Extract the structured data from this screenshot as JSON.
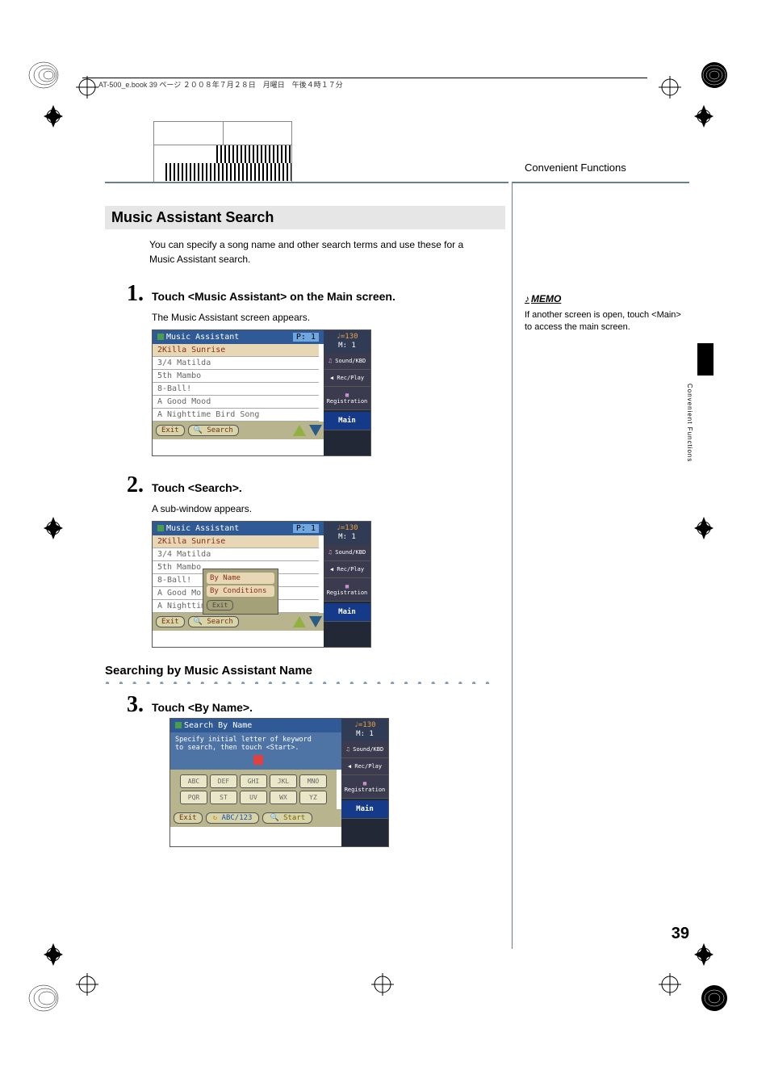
{
  "doc_header": "AT-500_e.book  39 ページ  ２００８年７月２８日　月曜日　午後４時１７分",
  "section_header": "Convenient Functions",
  "tab_text": "Convenient Functions",
  "page_number": "39",
  "h2": "Music Assistant Search",
  "intro_text": "You can specify a song name and other search terms and use these for a Music Assistant search.",
  "memo": {
    "label": "MEMO",
    "text": "If another screen is open, touch <Main> to access the main screen."
  },
  "steps": {
    "s1": {
      "num": "1.",
      "title": "Touch <Music Assistant> on the Main screen.",
      "body": "The Music Assistant screen appears."
    },
    "s2": {
      "num": "2.",
      "title": "Touch <Search>.",
      "body": "A sub-window appears."
    },
    "s3": {
      "num": "3.",
      "title": "Touch <By Name>."
    }
  },
  "subsection": "Searching by Music Assistant Name",
  "screenshot": {
    "title": "Music Assistant",
    "p_label": "P:  1",
    "songs": [
      "2Killa Sunrise",
      "3/4 Matilda",
      "5th Mambo",
      "8-Ball!",
      "A Good Mood",
      "A Nighttime Bird Song"
    ],
    "footer": {
      "exit": "Exit",
      "search": "Search"
    },
    "sidebar": {
      "tempo_top": "♩=130",
      "tempo_bottom": "M:      1",
      "btns": [
        "Sound/KBD",
        "Rec/Play",
        "Registration"
      ],
      "main": "Main"
    },
    "popup": {
      "opt1": "By Name",
      "opt2": "By Conditions",
      "exit": "Exit"
    }
  },
  "screenshot3": {
    "title": "Search By Name",
    "line1": "Specify initial letter of keyword",
    "line2": "to search, then touch <Start>.",
    "keys": [
      "ABC",
      "DEF",
      "GHI",
      "JKL",
      "MNO",
      "PQR",
      "ST",
      "UV",
      "WX",
      "YZ"
    ],
    "footer": {
      "exit": "Exit",
      "abc": "ABC/123",
      "start": "Start"
    }
  }
}
